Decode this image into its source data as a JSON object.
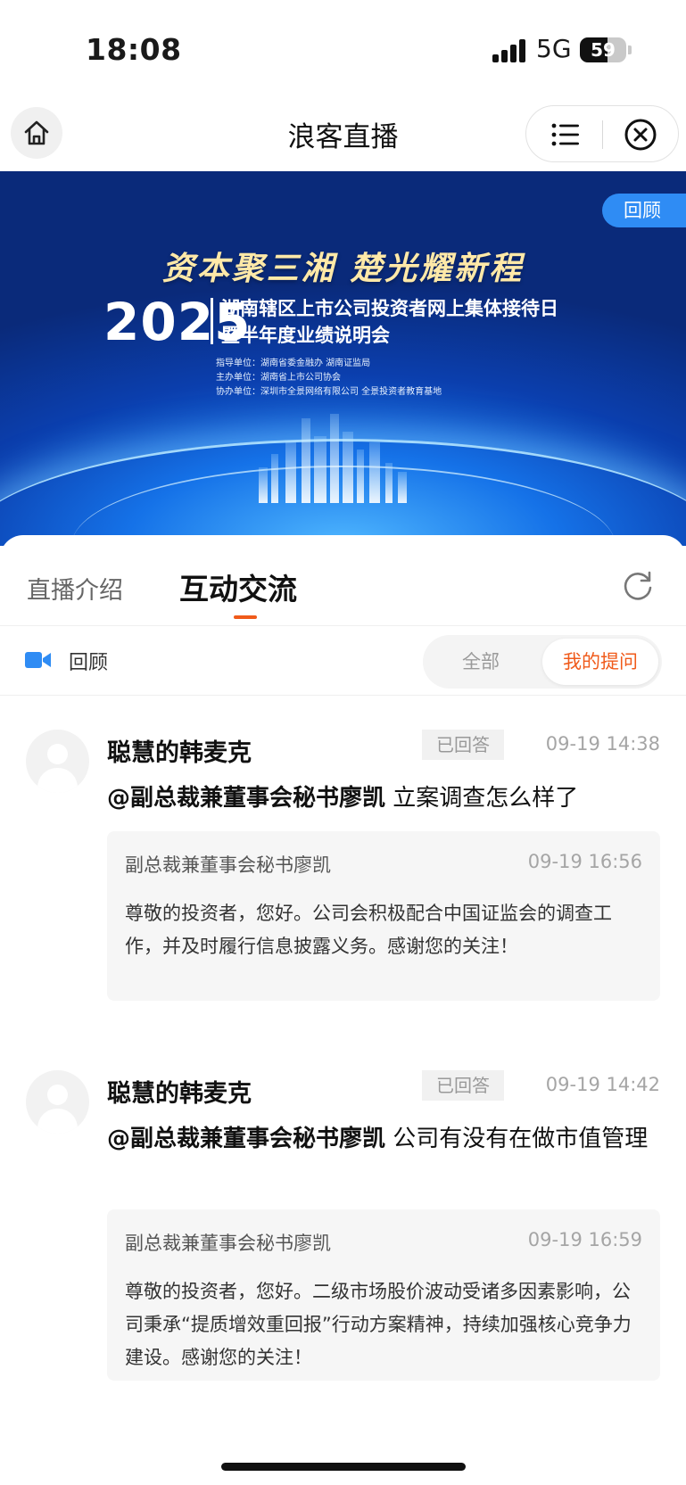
{
  "status_bar": {
    "time": "18:08",
    "network": "5G",
    "battery": "59",
    "battery_level": 0.59
  },
  "nav": {
    "title": "浪客直播",
    "icons": [
      "home-icon",
      "menu-icon",
      "close-icon"
    ]
  },
  "banner": {
    "slogan": "资本聚三湘  楚光耀新程",
    "year": "2025",
    "title_line1": "湖南辖区上市公司投资者网上集体接待日",
    "title_line2": "暨半年度业绩说明会",
    "guide": "指导单位：湖南省委金融办  湖南证监局",
    "host": "主办单位：湖南省上市公司协会",
    "co_host": "协办单位：深圳市全景网络有限公司  全景投资者教育基地",
    "replay_tag": "回顾"
  },
  "tabs": {
    "intro": "直播介绍",
    "interact": "互动交流",
    "active": "互动交流"
  },
  "filter": {
    "replay_label": "回顾",
    "all": "全部",
    "mine": "我的提问",
    "selected": "我的提问"
  },
  "questions": [
    {
      "user": "聪慧的韩麦克",
      "badge": "已回答",
      "time": "09-19 14:38",
      "mention": "@副总裁兼董事会秘书廖凯",
      "question": " 立案调查怎么样了",
      "answer_name": "副总裁兼董事会秘书廖凯",
      "answer_time": "09-19 16:56",
      "answer": "尊敬的投资者，您好。公司会积极配合中国证监会的调查工作，并及时履行信息披露义务。感谢您的关注！"
    },
    {
      "user": "聪慧的韩麦克",
      "badge": "已回答",
      "time": "09-19 14:42",
      "mention": "@副总裁兼董事会秘书廖凯",
      "question": " 公司有没有在做市值管理",
      "answer_name": "副总裁兼董事会秘书廖凯",
      "answer_time": "09-19 16:59",
      "answer": "尊敬的投资者，您好。二级市场股价波动受诸多因素影响，公司秉承“提质增效重回报”行动方案精神，持续加强核心竞争力建设。感谢您的关注！"
    }
  ]
}
